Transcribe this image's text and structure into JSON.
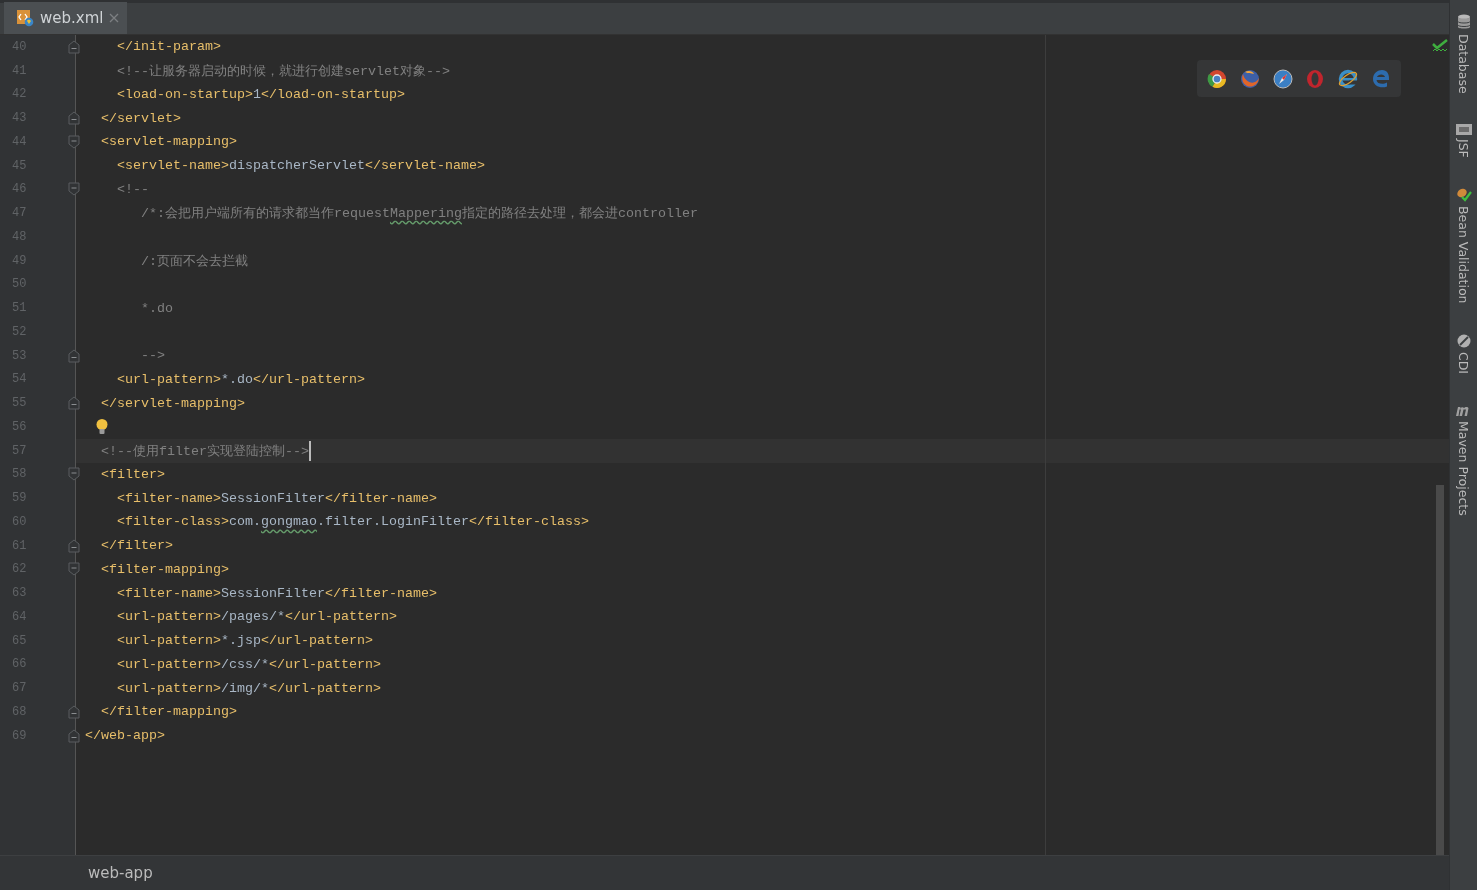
{
  "tabs": [
    {
      "label": "web.xml",
      "selected": true
    }
  ],
  "editor": {
    "lines": [
      {
        "number": "40",
        "fold_end": true,
        "current": false,
        "tokens": [
          {
            "kind": "tag",
            "text": "    </init-param>"
          }
        ]
      },
      {
        "number": "41",
        "current": false,
        "tokens": [
          {
            "kind": "comment",
            "text": "    <!--让服务器启动的时候，就进行创建servlet对象-->"
          }
        ]
      },
      {
        "number": "42",
        "current": false,
        "tokens": [
          {
            "kind": "tag",
            "text": "    <load-on-startup>"
          },
          {
            "kind": "text",
            "text": "1"
          },
          {
            "kind": "tag",
            "text": "</load-on-startup>"
          }
        ]
      },
      {
        "number": "43",
        "fold_end": true,
        "current": false,
        "tokens": [
          {
            "kind": "tag",
            "text": "  </servlet>"
          }
        ]
      },
      {
        "number": "44",
        "fold_start": true,
        "current": false,
        "tokens": [
          {
            "kind": "tag",
            "text": "  <servlet-mapping>"
          }
        ]
      },
      {
        "number": "45",
        "current": false,
        "tokens": [
          {
            "kind": "tag",
            "text": "    <servlet-name>"
          },
          {
            "kind": "text",
            "text": "dispatcherServlet"
          },
          {
            "kind": "tag",
            "text": "</servlet-name>"
          }
        ]
      },
      {
        "number": "46",
        "fold_start": true,
        "current": false,
        "tokens": [
          {
            "kind": "comment",
            "text": "    <!--"
          }
        ]
      },
      {
        "number": "47",
        "current": false,
        "tokens": [
          {
            "kind": "comment",
            "text": "       /*:会把用户端所有的请求都当作request"
          },
          {
            "kind": "typo-comment",
            "text": "Mappering"
          },
          {
            "kind": "comment",
            "text": "指定的路径去处理，都会进controller"
          }
        ]
      },
      {
        "number": "48",
        "current": false
      },
      {
        "number": "49",
        "current": false,
        "tokens": [
          {
            "kind": "comment",
            "text": "       /:页面不会去拦截"
          }
        ]
      },
      {
        "number": "50",
        "current": false
      },
      {
        "number": "51",
        "current": false,
        "tokens": [
          {
            "kind": "comment",
            "text": "       *.do"
          }
        ]
      },
      {
        "number": "52",
        "current": false
      },
      {
        "number": "53",
        "fold_end": true,
        "current": false,
        "tokens": [
          {
            "kind": "comment",
            "text": "       -->"
          }
        ]
      },
      {
        "number": "54",
        "current": false,
        "tokens": [
          {
            "kind": "tag",
            "text": "    <url-pattern>"
          },
          {
            "kind": "text",
            "text": "*.do"
          },
          {
            "kind": "tag",
            "text": "</url-pattern>"
          }
        ]
      },
      {
        "number": "55",
        "fold_end": true,
        "current": false,
        "tokens": [
          {
            "kind": "tag",
            "text": "  </servlet-mapping>"
          }
        ]
      },
      {
        "number": "56",
        "current": false,
        "bulb": true
      },
      {
        "number": "57",
        "current": true,
        "tokens": [
          {
            "kind": "comment",
            "text": "  <!--使用filter实现登陆控制-->"
          }
        ]
      },
      {
        "number": "58",
        "fold_start": true,
        "current": false,
        "tokens": [
          {
            "kind": "tag",
            "text": "  <filter>"
          }
        ]
      },
      {
        "number": "59",
        "current": false,
        "tokens": [
          {
            "kind": "tag",
            "text": "    <filter-name>"
          },
          {
            "kind": "text",
            "text": "SessionFilter"
          },
          {
            "kind": "tag",
            "text": "</filter-name>"
          }
        ]
      },
      {
        "number": "60",
        "current": false,
        "tokens": [
          {
            "kind": "tag",
            "text": "    <filter-class>"
          },
          {
            "kind": "text",
            "text": "com."
          },
          {
            "kind": "typo-text",
            "text": "gongmao"
          },
          {
            "kind": "text",
            "text": ".filter.LoginFilter"
          },
          {
            "kind": "tag",
            "text": "</filter-class>"
          }
        ]
      },
      {
        "number": "61",
        "fold_end": true,
        "current": false,
        "tokens": [
          {
            "kind": "tag",
            "text": "  </filter>"
          }
        ]
      },
      {
        "number": "62",
        "fold_start": true,
        "current": false,
        "tokens": [
          {
            "kind": "tag",
            "text": "  <filter-mapping>"
          }
        ]
      },
      {
        "number": "63",
        "current": false,
        "tokens": [
          {
            "kind": "tag",
            "text": "    <filter-name>"
          },
          {
            "kind": "text",
            "text": "SessionFilter"
          },
          {
            "kind": "tag",
            "text": "</filter-name>"
          }
        ]
      },
      {
        "number": "64",
        "current": false,
        "tokens": [
          {
            "kind": "tag",
            "text": "    <url-pattern>"
          },
          {
            "kind": "text",
            "text": "/pages/*"
          },
          {
            "kind": "tag",
            "text": "</url-pattern>"
          }
        ]
      },
      {
        "number": "65",
        "current": false,
        "tokens": [
          {
            "kind": "tag",
            "text": "    <url-pattern>"
          },
          {
            "kind": "text",
            "text": "*.jsp"
          },
          {
            "kind": "tag",
            "text": "</url-pattern>"
          }
        ]
      },
      {
        "number": "66",
        "current": false,
        "tokens": [
          {
            "kind": "tag",
            "text": "    <url-pattern>"
          },
          {
            "kind": "text",
            "text": "/css/*"
          },
          {
            "kind": "tag",
            "text": "</url-pattern>"
          }
        ]
      },
      {
        "number": "67",
        "current": false,
        "tokens": [
          {
            "kind": "tag",
            "text": "    <url-pattern>"
          },
          {
            "kind": "text",
            "text": "/img/*"
          },
          {
            "kind": "tag",
            "text": "</url-pattern>"
          }
        ]
      },
      {
        "number": "68",
        "fold_end": true,
        "current": false,
        "tokens": [
          {
            "kind": "tag",
            "text": "  </filter-mapping>"
          }
        ]
      },
      {
        "number": "69",
        "fold_end": true,
        "current": false,
        "tokens": [
          {
            "kind": "tag",
            "text": "</web-app>"
          }
        ]
      }
    ]
  },
  "breadcrumb": "web-app",
  "sidebar": {
    "items": [
      {
        "kind": "database",
        "label": "Database"
      },
      {
        "kind": "jsf",
        "label": "JSF"
      },
      {
        "kind": "bean",
        "label": "Bean Validation"
      },
      {
        "kind": "cdi",
        "label": "CDI"
      },
      {
        "kind": "maven",
        "label": "Maven Projects"
      }
    ]
  }
}
